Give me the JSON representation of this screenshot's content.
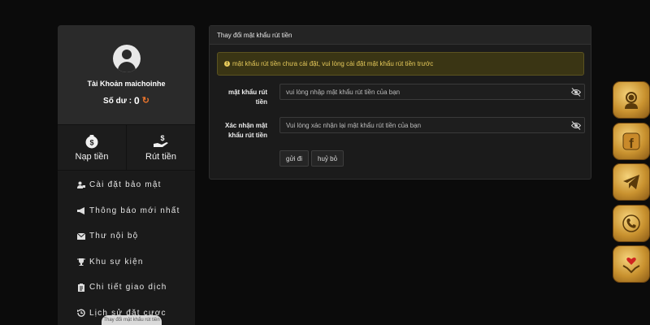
{
  "profile": {
    "username": "Tài Khoản maichoinhe",
    "balance_label": "Số dư :",
    "balance_value": "0"
  },
  "actions": [
    {
      "label": "Nạp tiền",
      "icon": "money-bag-icon"
    },
    {
      "label": "Rút tiền",
      "icon": "withdraw-hand-icon"
    }
  ],
  "menu": [
    {
      "label": "Cài đặt bảo mật",
      "icon": "user-lock-icon"
    },
    {
      "label": "Thông báo mới nhất",
      "icon": "megaphone-icon"
    },
    {
      "label": "Thư nội bộ",
      "icon": "envelope-icon"
    },
    {
      "label": "Khu sự kiện",
      "icon": "trophy-icon"
    },
    {
      "label": "Chi tiết giao dịch",
      "icon": "clipboard-icon"
    },
    {
      "label": "Lịch sử đặt cược",
      "icon": "history-icon"
    }
  ],
  "tooltip": "Thay đổi mật khẩu rút tiền",
  "panel": {
    "title": "Thay đổi mật khẩu rút tiền",
    "alert": "mật khẩu rút tiền chưa cài đặt, vui lòng cài đặt mật khẩu rút tiền trước",
    "fields": [
      {
        "label": "mật khẩu rút tiền",
        "placeholder": "vui lòng nhập mật khẩu rút tiền của bạn"
      },
      {
        "label": "Xác nhận mật khẩu rút tiền",
        "placeholder": "Vui lòng xác nhận lại mật khẩu rút tiền của bạn"
      }
    ],
    "submit_label": "gửi đi",
    "cancel_label": "huỷ bỏ"
  },
  "floating": [
    {
      "icon": "support-agent-icon"
    },
    {
      "icon": "facebook-icon"
    },
    {
      "icon": "telegram-icon"
    },
    {
      "icon": "phone-icon"
    },
    {
      "icon": "heart-hands-icon"
    }
  ],
  "colors": {
    "accent_orange": "#e8742c",
    "alert_text": "#e5c95a",
    "alert_bg": "#3a3514",
    "gold": "#c9922f"
  }
}
